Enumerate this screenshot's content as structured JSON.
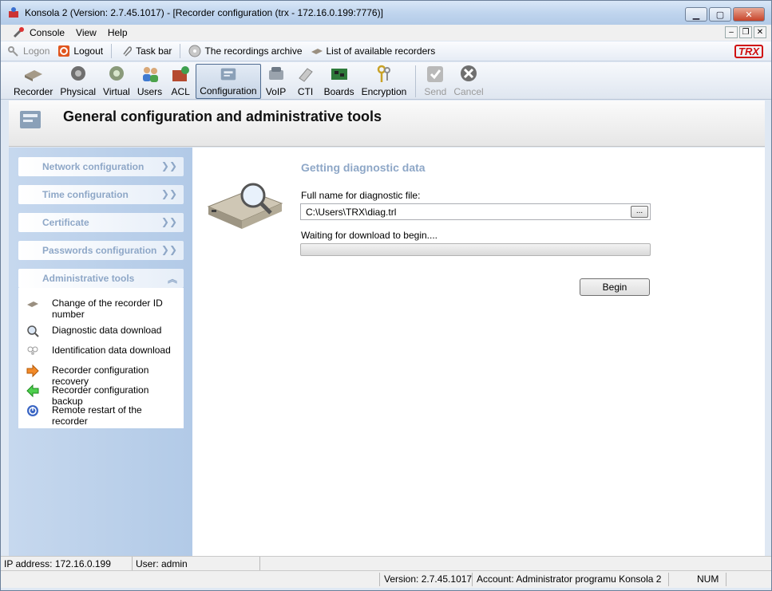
{
  "window": {
    "title": "Konsola 2 (Version:  2.7.45.1017) - [Recorder configuration (trx - 172.16.0.199:7776)]"
  },
  "menu": {
    "items": [
      "Console",
      "View",
      "Help"
    ]
  },
  "quickbar": {
    "logon": "Logon",
    "logout": "Logout",
    "taskbar": "Task bar",
    "archive": "The recordings archive",
    "recorders": "List of available recorders",
    "logo": "TRX"
  },
  "toolbar": {
    "items": [
      "Recorder",
      "Physical",
      "Virtual",
      "Users",
      "ACL",
      "Configuration",
      "VoIP",
      "CTI",
      "Boards",
      "Encryption",
      "Send",
      "Cancel"
    ]
  },
  "header": {
    "title": "General configuration and administrative tools"
  },
  "sidebar": {
    "sections": [
      "Network configuration",
      "Time configuration",
      "Certificate",
      "Passwords configuration",
      "Administrative tools"
    ],
    "tasks": [
      "Change of the recorder ID number",
      "Diagnostic data download",
      "Identification data download",
      "Recorder configuration recovery",
      "Recorder configuration backup",
      "Remote restart of the recorder"
    ]
  },
  "content": {
    "section_title": "Getting diagnostic data",
    "file_label": "Full name for diagnostic file:",
    "file_value": "C:\\Users\\TRX\\diag.trl",
    "browse_label": "...",
    "status_text": "Waiting for download to begin....",
    "progress": 0,
    "begin_label": "Begin"
  },
  "statusbar": {
    "ip": "IP address: 172.16.0.199",
    "user": "User: admin",
    "version": "Version: 2.7.45.1017",
    "account": "Account: Administrator programu Konsola 2",
    "num": "NUM"
  }
}
